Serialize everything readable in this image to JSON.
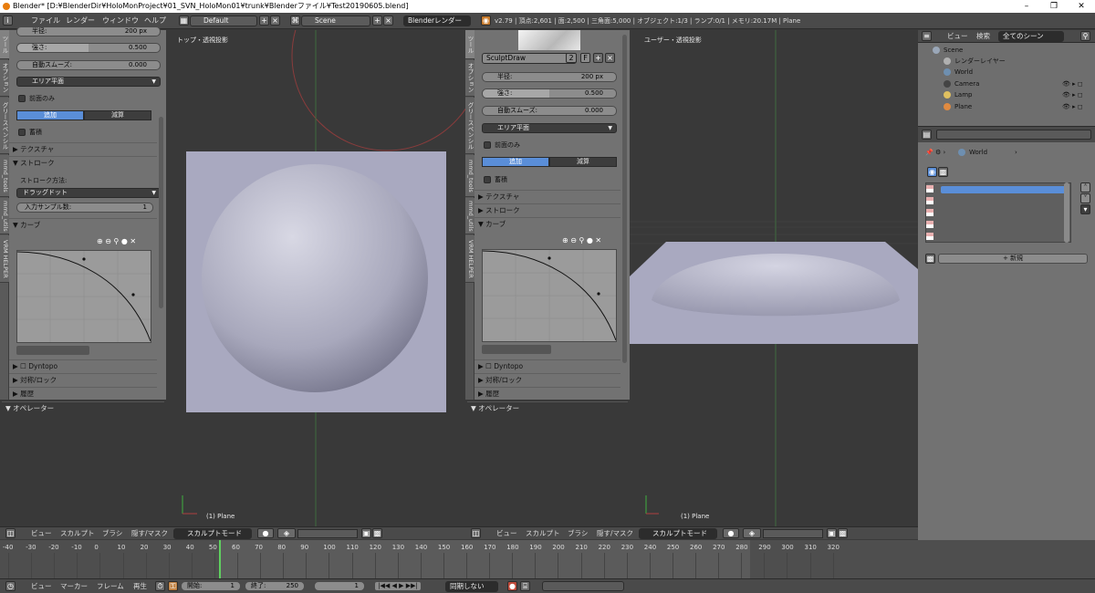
{
  "window": {
    "title": "Blender* [D:¥BlenderDir¥HoloMonProject¥01_SVN_HoloMon01¥trunk¥Blenderファイル¥Test20190605.blend]",
    "minimize": "–",
    "maximize": "❐",
    "close": "✕"
  },
  "infobar": {
    "menus": [
      "ファイル",
      "レンダー",
      "ウィンドウ",
      "ヘルプ"
    ],
    "layout": "Default",
    "scene": "Scene",
    "engine": "Blenderレンダー",
    "stats": "v2.79 | 頂点:2,601 | 面:2,500 | 三角面:5,000 | オブジェクト:1/3 | ランプ:0/1 | メモリ:20.17M | Plane"
  },
  "left_panel": {
    "tabs": [
      "ツール",
      "オプション",
      "グリースペンシル",
      "mmd_tools",
      "mmd_utils",
      "VRM HELPER"
    ],
    "radius_label": "半径:",
    "radius_value": "200 px",
    "strength_label": "強さ:",
    "strength_value": "0.500",
    "strength_fraction": 0.5,
    "autosmooth_label": "自動スムーズ:",
    "autosmooth_value": "0.000",
    "falloff": "エリア平面",
    "front_only": "前面のみ",
    "add": "追加",
    "subtract": "減算",
    "accumulate": "蓄積",
    "section_texture": "テクスチャ",
    "section_stroke": "ストローク",
    "stroke_method_label": "ストローク方法:",
    "stroke_method": "ドラッグドット",
    "input_samples_label": "入力サンプル数:",
    "input_samples_value": "1",
    "section_curve": "カーブ",
    "section_dyntopo": "Dyntopo",
    "section_symmetry": "対称/ロック",
    "section_history": "履歴",
    "section_operator": "オペレーター"
  },
  "mid_panel": {
    "brush_name": "SculptDraw",
    "brush_users": "2",
    "brush_fake": "F",
    "radius_label": "半径:",
    "radius_value": "200 px",
    "strength_label": "強さ:",
    "strength_value": "0.500",
    "strength_fraction": 0.5,
    "autosmooth_label": "自動スムーズ:",
    "autosmooth_value": "0.000",
    "falloff": "エリア平面",
    "front_only": "前面のみ",
    "add": "追加",
    "subtract": "減算",
    "accumulate": "蓄積",
    "section_texture": "テクスチャ",
    "section_stroke": "ストローク",
    "section_curve": "カーブ",
    "section_dyntopo": "Dyntopo",
    "section_symmetry": "対称/ロック",
    "section_history": "履歴",
    "section_operator": "オペレーター"
  },
  "viewport_left": {
    "label": "トップ・透視投影",
    "object": "(1) Plane"
  },
  "viewport_right": {
    "label": "ユーザー・透視投影",
    "object": "(1) Plane"
  },
  "viewport_footer": {
    "menus": [
      "ビュー",
      "スカルプト",
      "ブラシ",
      "隠す/マスク"
    ],
    "mode": "スカルプトモード"
  },
  "outliner": {
    "header_menus": [
      "ビュー",
      "検索"
    ],
    "scope": "全てのシーン",
    "items": [
      {
        "label": "Scene",
        "color": "#9aa7b8"
      },
      {
        "label": "レンダーレイヤー",
        "color": "#b0b0b0"
      },
      {
        "label": "World",
        "color": "#6e8fb0"
      },
      {
        "label": "Camera",
        "color": "#444444"
      },
      {
        "label": "Lamp",
        "color": "#e0c060"
      },
      {
        "label": "Plane",
        "color": "#e08a40"
      }
    ]
  },
  "properties": {
    "breadcrumb": "World",
    "new_button": "新規"
  },
  "timeline": {
    "ticks": [
      "-40",
      "-30",
      "-20",
      "-10",
      "0",
      "10",
      "20",
      "30",
      "40",
      "50",
      "60",
      "70",
      "80",
      "90",
      "100",
      "110",
      "120",
      "130",
      "140",
      "150",
      "160",
      "170",
      "180",
      "190",
      "200",
      "210",
      "220",
      "230",
      "240",
      "250",
      "260",
      "270",
      "280",
      "290",
      "300",
      "310",
      "320"
    ],
    "menus": [
      "ビュー",
      "マーカー",
      "フレーム",
      "再生"
    ],
    "start_label": "開始:",
    "start_value": "1",
    "end_label": "終了:",
    "end_value": "250",
    "current_frame": "1",
    "sync": "同期しない"
  },
  "colors": {
    "accent_blue": "#5a8ed8",
    "panel": "#727272",
    "viewport": "#393939",
    "mesh": "#a9a9c0"
  }
}
